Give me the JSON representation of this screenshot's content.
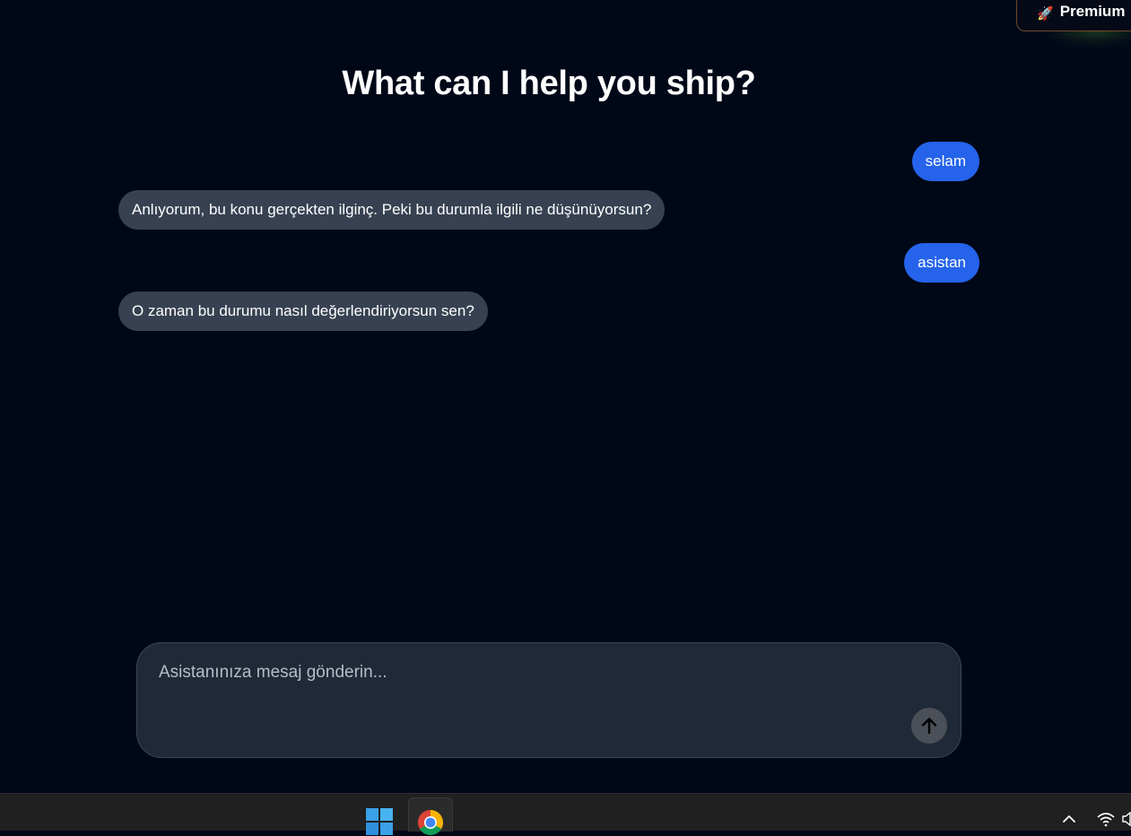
{
  "header": {
    "premium_label": "Premium",
    "premium_icon": "rocket-icon"
  },
  "main": {
    "title": "What can I help you ship?"
  },
  "messages": [
    {
      "role": "user",
      "text": "selam"
    },
    {
      "role": "assistant",
      "text": "Anlıyorum, bu konu gerçekten ilginç. Peki bu durumla ilgili ne düşünüyorsun?"
    },
    {
      "role": "user",
      "text": "asistan"
    },
    {
      "role": "assistant",
      "text": "O zaman bu durumu nasıl değerlendiriyorsun sen?"
    }
  ],
  "composer": {
    "placeholder": "Asistanınıza mesaj gönderin...",
    "value": "",
    "send_icon": "arrow-up-icon"
  },
  "taskbar": {
    "icons": [
      "windows-start-icon",
      "chrome-icon",
      "chevron-up-icon",
      "wifi-icon",
      "speaker-icon"
    ]
  },
  "colors": {
    "background": "#000818",
    "user_bubble": "#2563eb",
    "assistant_bubble": "#374151",
    "composer": "#1f2937",
    "send_button": "#4b4f57",
    "taskbar": "#202020"
  }
}
